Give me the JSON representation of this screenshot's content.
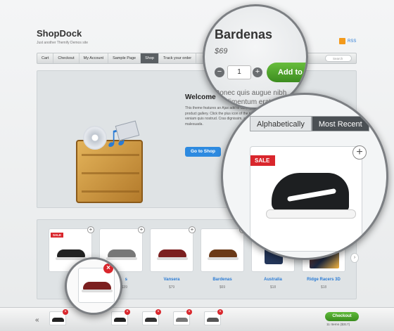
{
  "site": {
    "logo": "ShopDock",
    "tagline": "Just another Themify Demos site",
    "rss_label": "RSS"
  },
  "nav": {
    "items": [
      "Cart",
      "Checkout",
      "My Account",
      "Sample Page",
      "Shop",
      "Track your order"
    ],
    "active": "Shop",
    "search_placeholder": "Search"
  },
  "hero": {
    "title": "Welcome",
    "body": "This theme features an Ajax add to cart, lightbox and flip-card product gallery. Click the plus icon of the product. Ut enim ad minim veniam quis nostrud. Cras dignissim, arcu vel sagittis condimentum malesuada.",
    "button_label": "Go to Shop"
  },
  "products": [
    {
      "name": "",
      "price": "",
      "sale": true
    },
    {
      "name": "",
      "price": "",
      "sale": false
    },
    {
      "name": "Vansera",
      "price": "$79",
      "sale": false
    },
    {
      "name": "Bardenas",
      "price": "$69",
      "sale": false
    },
    {
      "name": "Australia",
      "price": "$18",
      "sale": false
    },
    {
      "name": "Ridge Racers 3D",
      "price": "$18",
      "sale": false
    }
  ],
  "product_labels_partial": {
    "p2_name": "s",
    "p2_price": "$39"
  },
  "lens_product": {
    "name": "Bardenas",
    "price": "$69",
    "qty": "1",
    "add_label": "Add to",
    "text": "Donec quis augue nibh condimentum erat"
  },
  "sort_tabs": {
    "alphabetical": "Alphabetically",
    "recent": "Most Recent",
    "sale_label": "SALE"
  },
  "cart_bar": {
    "checkout_label": "Checkout",
    "items_text": "11 Items ($317)"
  },
  "colors": {
    "accent_blue": "#2d8ae0",
    "sale_red": "#d9262c",
    "checkout_green": "#3a8d1f"
  }
}
